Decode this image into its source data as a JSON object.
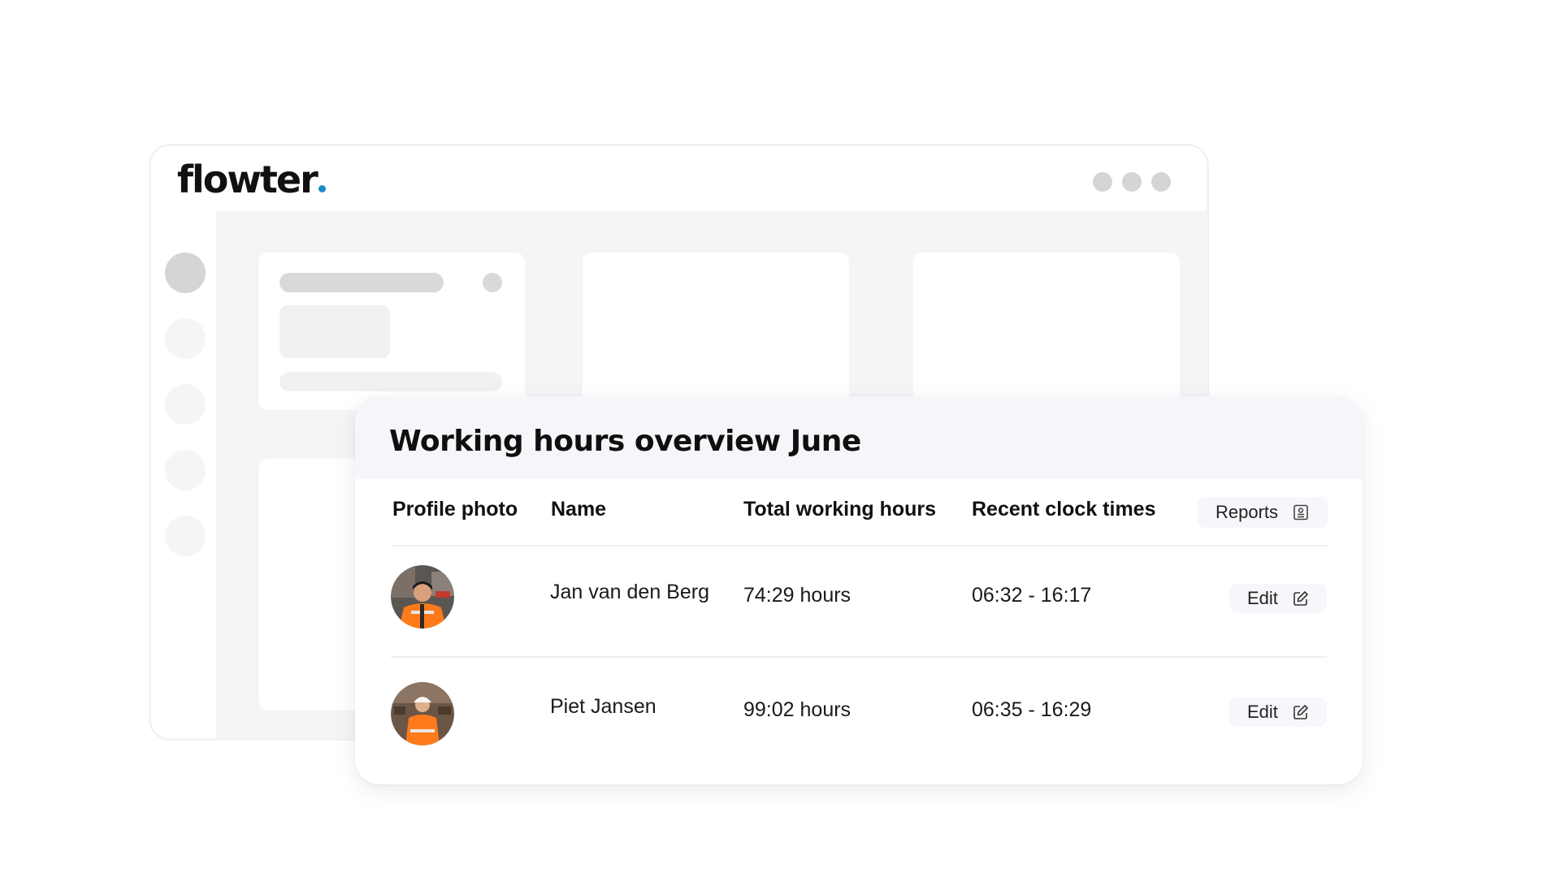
{
  "brand": {
    "logo_text": "flowter",
    "dot_color": "#1e88c8"
  },
  "panel": {
    "title": "Working hours overview June",
    "columns": [
      "Profile photo",
      "Name",
      "Total working hours",
      "Recent clock times"
    ],
    "reports_label": "Reports",
    "rows": [
      {
        "name": "Jan van den Berg",
        "hours": "74:29 hours",
        "clock": "06:32 - 16:17",
        "edit_label": "Edit"
      },
      {
        "name": "Piet Jansen",
        "hours": "99:02 hours",
        "clock": "06:35 - 16:29",
        "edit_label": "Edit"
      }
    ]
  },
  "icons": {
    "reports": "report-document-icon",
    "edit": "edit-pencil-icon"
  },
  "colors": {
    "accent": "#1e88c8",
    "safety_orange": "#ff7a1a"
  }
}
